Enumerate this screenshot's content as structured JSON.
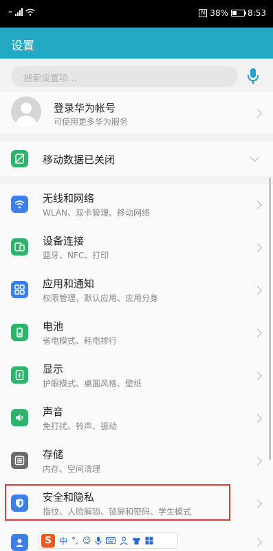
{
  "status_bar": {
    "carrier_mark": "⁴⁶",
    "battery": "38%",
    "time": "8:53",
    "nfc": "N"
  },
  "app_bar": {
    "title": "设置"
  },
  "search": {
    "placeholder": "搜索设置项..."
  },
  "account": {
    "title": "登录华为帐号",
    "subtitle": "可使用更多华为服务"
  },
  "mobile_data": {
    "label": "移动数据已关闭"
  },
  "settings": [
    {
      "title": "无线和网络",
      "subtitle": "WLAN、双卡管理、移动网络",
      "icon": "wifi-icon",
      "color": "#3d7fe6"
    },
    {
      "title": "设备连接",
      "subtitle": "蓝牙、NFC、打印",
      "icon": "device-connection-icon",
      "color": "#2fb36a"
    },
    {
      "title": "应用和通知",
      "subtitle": "权限管理、默认应用、应用分身",
      "icon": "apps-icon",
      "color": "#3d7fe6"
    },
    {
      "title": "电池",
      "subtitle": "省电模式、耗电排行",
      "icon": "battery-icon",
      "color": "#2fb36a"
    },
    {
      "title": "显示",
      "subtitle": "护眼模式、桌面风格、壁纸",
      "icon": "display-icon",
      "color": "#2fb36a"
    },
    {
      "title": "声音",
      "subtitle": "免打扰、铃声、振动",
      "icon": "sound-icon",
      "color": "#2fb36a"
    },
    {
      "title": "存储",
      "subtitle": "内存、空间清理",
      "icon": "storage-icon",
      "color": "#6b6b6b"
    },
    {
      "title": "安全和隐私",
      "subtitle": "指纹、人脸解锁、锁屏和密码、学生模式",
      "icon": "shield-icon",
      "color": "#3d7fe6"
    }
  ],
  "ime_toolbar": {
    "logo": "S",
    "mode": "中",
    "punct": "°,"
  },
  "colors": {
    "accent": "#24a9c5",
    "highlight": "#e03a3a"
  }
}
